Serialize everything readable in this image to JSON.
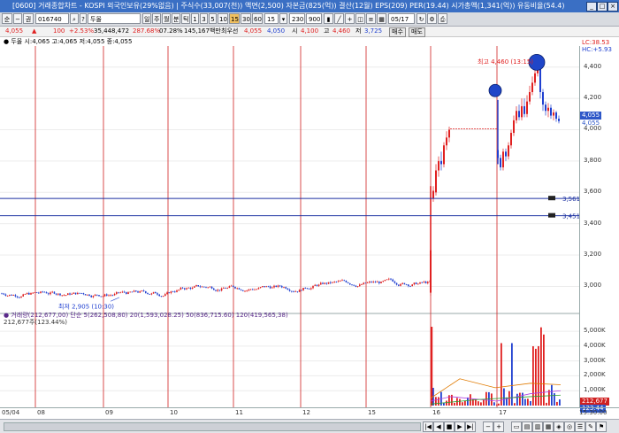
{
  "window": {
    "title": "[0600] 거래종합차트 - KOSPI 외국인보유(29%없음) | 주식수(33,007(천)) 액면(2,500) 자본금(825(억)) 결산(12월) EPS(209) PER(19.44) 시가총액(1,341(억)) 유동비율(54.4)",
    "min": "_",
    "max": "□",
    "close": "×"
  },
  "toolbar": {
    "items": [
      "순",
      "−",
      "권",
      "016740",
      "",
      "두올",
      "일",
      "주",
      "월",
      "분",
      "틱",
      "1",
      "3",
      "5",
      "10",
      "15",
      "30",
      "60",
      "15",
      "▾",
      "230",
      "900",
      "",
      "",
      "",
      "",
      "",
      "",
      "05/17",
      "",
      "",
      ""
    ],
    "code": "016740",
    "name": "두올",
    "period_value": "15",
    "count": "230",
    "count2": "900",
    "date": "05/17"
  },
  "quote": {
    "price": "4,055",
    "arrow": "▲",
    "change": "100",
    "rate": "+2.53%",
    "volume": "35,448,472",
    "vol_ratio": "287.68%",
    "turnover": "07.28%",
    "amount": "145,167백만",
    "label_high": "최우선",
    "ask": "4,055",
    "bid": "4,050",
    "label_o": "시",
    "open": "4,100",
    "label_h": "고",
    "high": "4,460",
    "label_l": "저",
    "low": "3,725",
    "buy_label": "매수",
    "sell_label": "매도"
  },
  "price_pane": {
    "header": "● 두올 시:4,065 고:4,065 저:4,055 종:4,055",
    "low_label": "최저 2,905 (10:30)",
    "high_label": "최고 4,460 (13:15)",
    "lc_label": "LC:38.53",
    "hc_label": "HC:+5.93",
    "current_flag": "4,055",
    "current_flag2": "4,055",
    "line1_label": "3,561",
    "line2_label": "3,451",
    "yticks": [
      "4,400",
      "4,200",
      "4,000",
      "3,800",
      "3,600",
      "3,400",
      "3,200",
      "3,000"
    ]
  },
  "volume_pane": {
    "header": "● 거래량(212,677,00) 단순 5(262,508,80) 20(1,593,028.25) 50(836,715.60) 120(419,565,38)",
    "header2": "212,677주(123.44%)",
    "vol_flag": "212,677",
    "vol_flag2": "123,44",
    "yticks": [
      "5,000K",
      "4,000K",
      "3,000K",
      "2,000K",
      "1,000K"
    ]
  },
  "xaxis": {
    "ticks": [
      "05/04",
      "08",
      "09",
      "10",
      "11",
      "12",
      "15",
      "16",
      "17"
    ],
    "right_label": "15:30:00"
  },
  "chart_data": {
    "type": "candlestick",
    "price_ylim": [
      2850,
      4500
    ],
    "candles_before_jump": 340,
    "base_level": 3000,
    "jump_close": 3850,
    "session_high": 4460,
    "session_low": 2905,
    "last_close": 4055,
    "hlines": [
      3561,
      3451
    ]
  },
  "colors": {
    "up": "#e02020",
    "down": "#2040d0",
    "grid_v": "#d02020",
    "hline": "#1a2fa0"
  }
}
